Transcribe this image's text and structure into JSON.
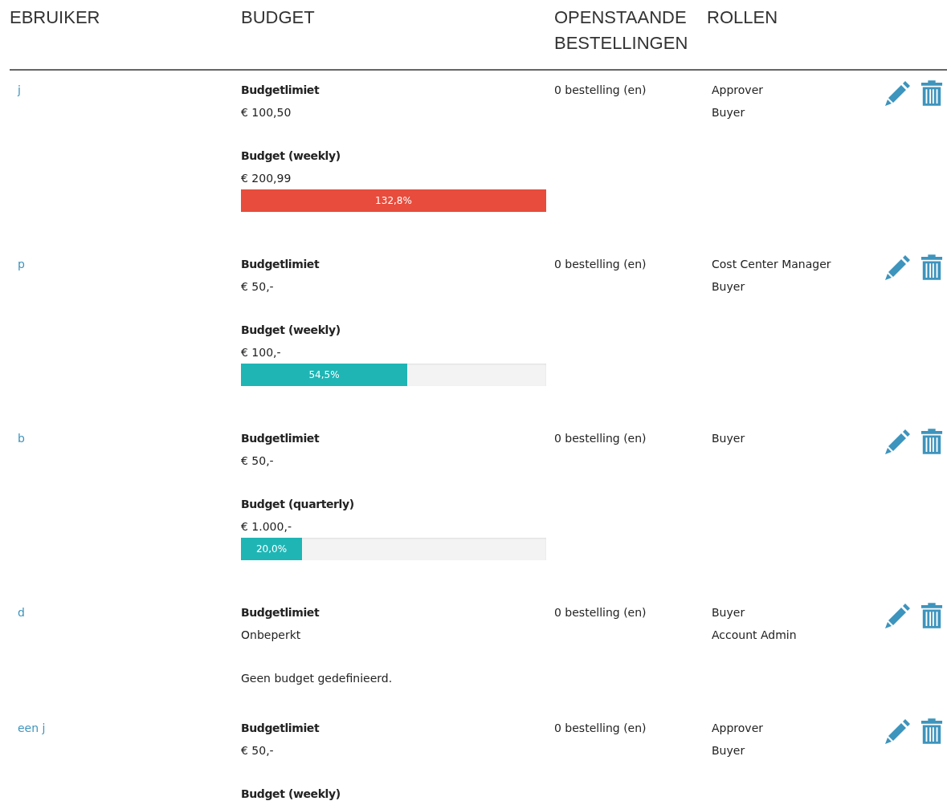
{
  "table": {
    "columns": [
      {
        "label": "EBRUIKER"
      },
      {
        "label": "BUDGET"
      },
      {
        "label": "OPENSTAANDE BESTELLINGEN"
      },
      {
        "label": "ROLLEN"
      }
    ],
    "rows": [
      {
        "user": "j",
        "limit_label": "Budgetlimiet",
        "limit_value": "€ 100,50",
        "budget": {
          "kind": "bar",
          "label": "Budget (weekly)",
          "value": "€ 200,99",
          "level": 1,
          "reading": "132,8%",
          "color": "#e74c3c"
        },
        "orders": "0 bestelling (en)",
        "roles": [
          "Approver",
          "Buyer"
        ]
      },
      {
        "user": "p",
        "limit_label": "Budgetlimiet",
        "limit_value": "€ 50,-",
        "budget": {
          "kind": "bar",
          "label": "Budget (weekly)",
          "value": "€ 100,-",
          "level": 0.545,
          "reading": "54,5%",
          "color": "#1fb5b5"
        },
        "orders": "0 bestelling (en)",
        "roles": [
          "Cost Center Manager",
          "Buyer"
        ]
      },
      {
        "user": "b",
        "limit_label": "Budgetlimiet",
        "limit_value": "€ 50,-",
        "budget": {
          "kind": "bar",
          "label": "Budget (quarterly)",
          "value": "€ 1.000,-",
          "level": 0.2,
          "reading": "20,0%",
          "color": "#1fb5b5"
        },
        "orders": "0 bestelling (en)",
        "roles": [
          "Buyer"
        ]
      },
      {
        "user": "d",
        "limit_label": "Budgetlimiet",
        "limit_value": "Onbeperkt",
        "budget": {
          "kind": "note",
          "text": "Geen budget gedefinieerd."
        },
        "orders": "0 bestelling (en)",
        "roles": [
          "Buyer",
          "Account Admin"
        ]
      },
      {
        "user": "een j",
        "limit_label": "Budgetlimiet",
        "limit_value": "€ 50,-",
        "budget": {
          "kind": "cut",
          "label": "Budget (weekly)"
        },
        "orders": "0 bestelling (en)",
        "roles": [
          "Approver",
          "Buyer"
        ]
      }
    ]
  }
}
